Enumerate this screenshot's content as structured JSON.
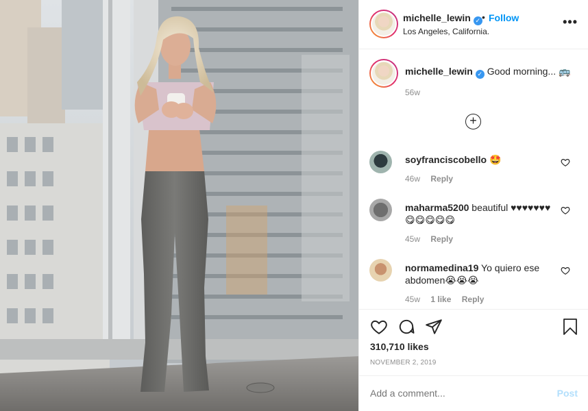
{
  "post": {
    "username": "michelle_lewin",
    "follow_label": "Follow",
    "separator": "•",
    "location": "Los Angeles, California.",
    "more_label": "•••",
    "caption": {
      "username": "michelle_lewin",
      "text": "Good morning... 🚌",
      "time": "56w"
    },
    "load_more_label": "+"
  },
  "comments": [
    {
      "username": "soyfranciscobello",
      "text": "🤩",
      "time": "46w",
      "likes": "",
      "reply_label": "Reply"
    },
    {
      "username": "maharma5200",
      "text": "beautiful ♥♥♥♥♥♥♥😋😋😋😋😋",
      "time": "45w",
      "likes": "",
      "reply_label": "Reply"
    },
    {
      "username": "normamedina19",
      "text": "Yo quiero ese abdomen😭😭😭",
      "time": "45w",
      "likes": "1 like",
      "reply_label": "Reply"
    }
  ],
  "footer": {
    "likes": "310,710 likes",
    "date": "NOVEMBER 2, 2019",
    "comment_placeholder": "Add a comment...",
    "post_label": "Post"
  },
  "colors": {
    "link_blue": "#0095f6",
    "post_disabled": "#b2dffc",
    "muted": "#8e8e8e",
    "verified": "#3897f0"
  },
  "icons": [
    "verified-badge-icon",
    "more-options-icon",
    "add-circle-icon",
    "heart-icon",
    "comment-icon",
    "share-icon",
    "bookmark-icon"
  ]
}
